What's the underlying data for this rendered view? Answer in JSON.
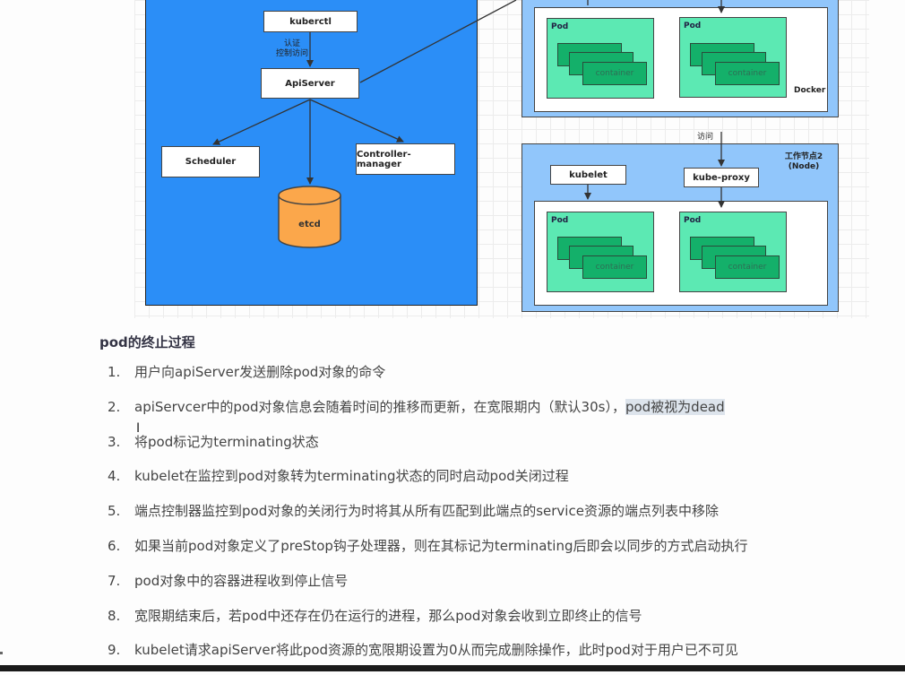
{
  "diagram": {
    "master": {
      "kubectl": "kuberctl",
      "auth_label_line1": "认证",
      "auth_label_line2": "控制访问",
      "apiserver": "ApiServer",
      "scheduler": "Scheduler",
      "controller_manager": "Controller-manager",
      "etcd": "etcd"
    },
    "node1": {
      "runtime_label": "Docker",
      "pods": [
        {
          "label": "Pod",
          "container": "container"
        },
        {
          "label": "Pod",
          "container": "container"
        }
      ]
    },
    "access_label": "访问",
    "node2": {
      "title_line1": "工作节点2",
      "title_line2": "(Node)",
      "kubelet": "kubelet",
      "kube_proxy": "kube-proxy",
      "pods": [
        {
          "label": "Pod",
          "container": "container"
        },
        {
          "label": "Pod",
          "container": "container"
        }
      ]
    },
    "colors": {
      "master_bg": "#2b8ef7",
      "node_bg": "#91c6fb",
      "pod_bg": "#5ce9b3",
      "container_bg": "#14b06a",
      "etcd_bg": "#fba74b"
    }
  },
  "doc": {
    "section_title": "pod的终止过程",
    "steps": [
      {
        "num": "1.",
        "text": "用户向apiServer发送删除pod对象的命令"
      },
      {
        "num": "2.",
        "text": "apiServcer中的pod对象信息会随着时间的推移而更新，在宽限期内（默认30s），",
        "highlight": "pod被视为dead"
      },
      {
        "num": "3.",
        "text": "将pod标记为terminating状态"
      },
      {
        "num": "4.",
        "text": "kubelet在监控到pod对象转为terminating状态的同时启动pod关闭过程"
      },
      {
        "num": "5.",
        "text": "端点控制器监控到pod对象的关闭行为时将其从所有匹配到此端点的service资源的端点列表中移除"
      },
      {
        "num": "6.",
        "text": "如果当前pod对象定义了preStop钩子处理器，则在其标记为terminating后即会以同步的方式启动执行"
      },
      {
        "num": "7.",
        "text": "pod对象中的容器进程收到停止信号"
      },
      {
        "num": "8.",
        "text": "宽限期结束后，若pod中还存在仍在运行的进程，那么pod对象会收到立即终止的信号"
      },
      {
        "num": "9.",
        "text": "kubelet请求apiServer将此pod资源的宽限期设置为0从而完成删除操作，此时pod对于用户已不可见"
      }
    ]
  }
}
